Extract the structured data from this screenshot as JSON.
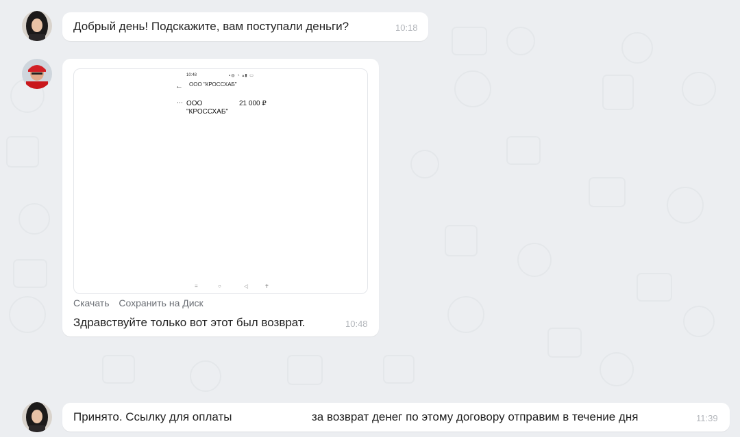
{
  "colors": {
    "background": "#eceef1",
    "bubble": "#ffffff",
    "time": "#b3b6bb",
    "text": "#222222"
  },
  "messages": [
    {
      "text": "Добрый день! Подскажите, вам поступали деньги?",
      "time": "10:18",
      "avatar": "female-avatar"
    },
    {
      "avatar": "male-avatar-red",
      "attachment": {
        "status_time": "10:48",
        "status_icons": "▪◍ ◔ ▴▮ ▭",
        "header": "ООО \"КРОССХАБ\"",
        "org_line1": "ООО",
        "org_line2": "\"КРОССХАБ\"",
        "amount": "21 000 ₽",
        "actions": {
          "download": "Скачать",
          "save": "Сохранить на Диск"
        }
      },
      "text": "Здравствуйте только вот этот был возврат.",
      "time": "10:48"
    },
    {
      "avatar": "female-avatar",
      "text_part1": "Принято. Ссылку для оплаты",
      "text_part2": "за возврат денег по этому договору отправим в течение дня",
      "time": "11:39"
    }
  ]
}
